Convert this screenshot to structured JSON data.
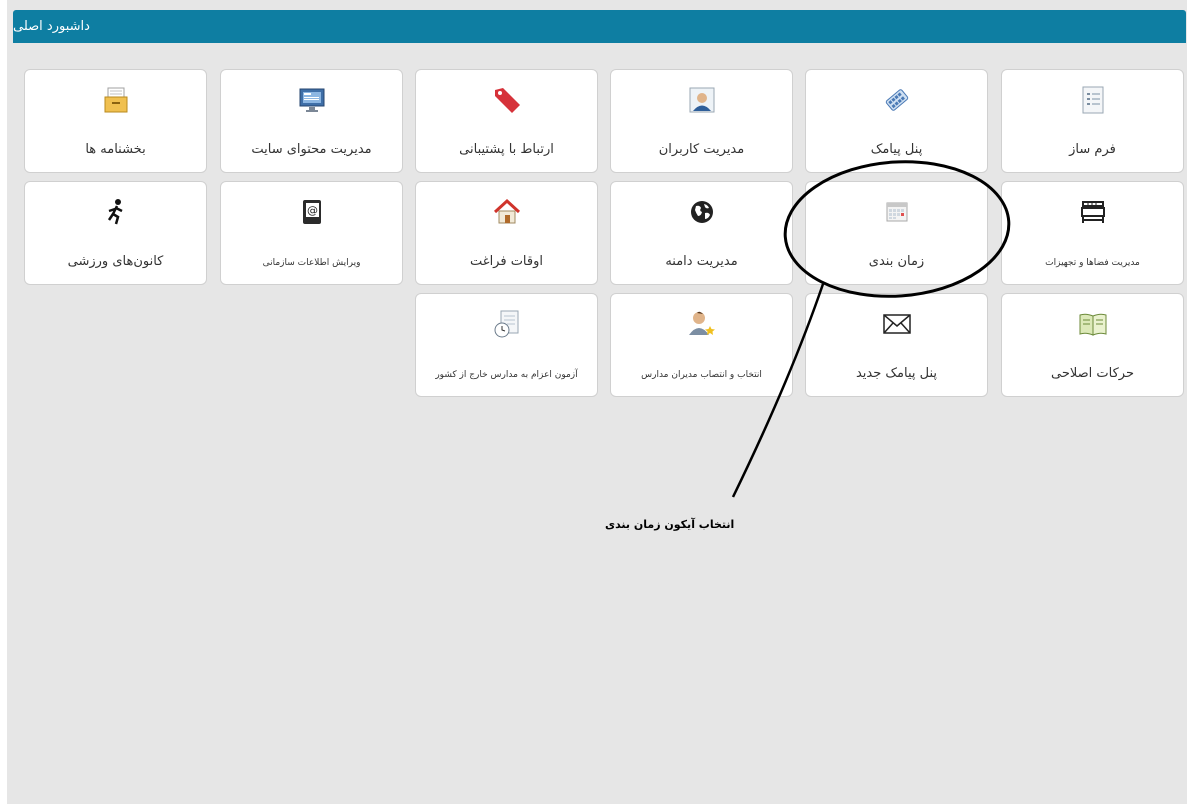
{
  "header": {
    "title": "داشبورد اصلی"
  },
  "tiles": {
    "form_builder": {
      "label": "فرم ساز",
      "icon": "form-icon"
    },
    "sms_panel": {
      "label": "پنل پیامک",
      "icon": "phone-keypad-icon"
    },
    "user_management": {
      "label": "مدیریت کاربران",
      "icon": "user-card-icon"
    },
    "support": {
      "label": "ارتباط با پشتیبانی",
      "icon": "tag-icon"
    },
    "site_content": {
      "label": "مدیریت محتوای سایت",
      "icon": "monitor-icon"
    },
    "circulars": {
      "label": "بخشنامه ها",
      "icon": "archive-box-icon"
    },
    "spaces_equipment": {
      "label": "مدیریت فضاها و تجهیزات",
      "icon": "bed-icon"
    },
    "scheduling": {
      "label": "زمان بندی",
      "icon": "calendar-icon"
    },
    "domain_management": {
      "label": "مدیریت دامنه",
      "icon": "globe-icon"
    },
    "free_time": {
      "label": "اوقات فراغت",
      "icon": "house-icon"
    },
    "org_info": {
      "label": "ویرایش اطلاعات سازمانی",
      "icon": "at-book-icon"
    },
    "sports_clubs": {
      "label": "کانون‌های ورزشی",
      "icon": "running-icon"
    },
    "corrective_moves": {
      "label": "حرکات اصلاحی",
      "icon": "open-book-icon"
    },
    "new_sms_panel": {
      "label": "پنل پیامک جدید",
      "icon": "envelope-icon"
    },
    "principal_select": {
      "label": "انتخاب و انتصاب مدیران مدارس",
      "icon": "user-star-icon"
    },
    "foreign_schools": {
      "label": "آزمون اعزام به مدارس خارج از کشور",
      "icon": "doc-clock-icon"
    }
  },
  "annotation": {
    "text": "انتخاب آیکون زمان بندی"
  },
  "colors": {
    "header": "#0e7ea2",
    "background": "#e6e6e6",
    "tile": "#ffffff"
  }
}
